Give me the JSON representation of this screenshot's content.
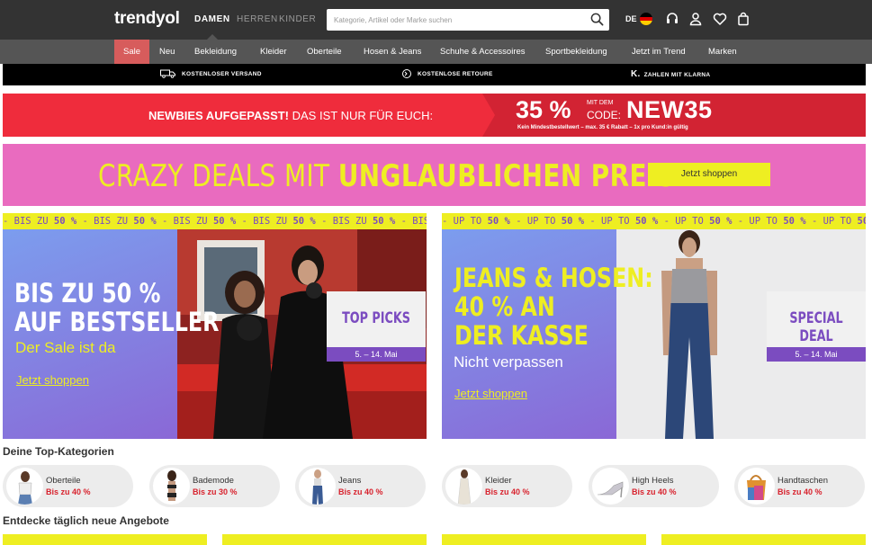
{
  "header": {
    "logo": "trendyol",
    "gender_tabs": [
      {
        "label": "DAMEN",
        "active": true
      },
      {
        "label": "HERREN",
        "active": false
      },
      {
        "label": "KINDER",
        "active": false
      }
    ],
    "search": {
      "placeholder": "Kategorie, Artikel oder Marke suchen",
      "icon": "search-icon"
    },
    "language": "DE",
    "icons": [
      "headset-icon",
      "user-icon",
      "heart-icon",
      "shopping-bag-icon"
    ]
  },
  "nav": {
    "items": [
      "Sale",
      "Neu",
      "Bekleidung",
      "Kleider",
      "Oberteile",
      "Hosen & Jeans",
      "Schuhe & Accessoires",
      "Sportbekleidung",
      "Jetzt im Trend",
      "Marken"
    ]
  },
  "usp": {
    "items": [
      {
        "label": "KOSTENLOSER VERSAND",
        "icon": "truck-icon"
      },
      {
        "label": "KOSTENLOSE RETOURE",
        "icon": "return-icon"
      },
      {
        "label": "ZAHLEN MIT KLARNA",
        "icon": "klarna-icon"
      }
    ]
  },
  "promo": {
    "headline_bold": "NEWBIES AUFGEPASST!",
    "headline_rest": " DAS IST NUR FÜR EUCH:",
    "percent": "35 %",
    "mit_dem": "MIT DEM",
    "code_label": "CODE:",
    "code": "NEW35",
    "fine_print": "Kein Mindestbestellwert – max. 35 € Rabatt – 1x pro Kund:in gültig"
  },
  "crazy": {
    "text_normal": "CRAZY DEALS MIT ",
    "text_bold": "UNGLAUBLICHEN PREISEN",
    "button": "Jetzt shoppen"
  },
  "banners": [
    {
      "ticker_pre": "- BIS ZU ",
      "ticker_bold": "50 %",
      "headline": [
        "BIS ZU 50 %",
        "AUF BESTSELLER"
      ],
      "subline": "Der Sale ist da",
      "link": "Jetzt shoppen",
      "badge_title": "TOP PICKS",
      "badge_date": "5. – 14. Mai"
    },
    {
      "ticker_pre": "- UP TO ",
      "ticker_bold": "50 %",
      "headline": [
        "JEANS & HOSEN:",
        "40 % AN",
        "DER KASSE"
      ],
      "subline": "Nicht verpassen",
      "link": "Jetzt shoppen",
      "badge_title": "SPECIAL DEAL",
      "badge_date": "5. – 14. Mai"
    }
  ],
  "top_categories": {
    "title": "Deine Top-Kategorien",
    "items": [
      {
        "name": "Oberteile",
        "discount": "Bis zu 40 %"
      },
      {
        "name": "Bademode",
        "discount": "Bis zu 30 %"
      },
      {
        "name": "Jeans",
        "discount": "Bis zu 40 %"
      },
      {
        "name": "Kleider",
        "discount": "Bis zu 40 %"
      },
      {
        "name": "High Heels",
        "discount": "Bis zu 40 %"
      },
      {
        "name": "Handtaschen",
        "discount": "Bis zu 40 %"
      }
    ]
  },
  "daily_deals": {
    "title": "Entdecke täglich neue Angebote"
  },
  "colors": {
    "header_bg": "#333333",
    "nav_bg": "#555555",
    "sale_bg": "#d75c5c",
    "promo_red": "#ef2c3c",
    "crazy_pink": "#e96bbf",
    "accent_yellow": "#eeee22",
    "badge_purple": "#7b4cc0",
    "discount_red": "#d8222d"
  }
}
